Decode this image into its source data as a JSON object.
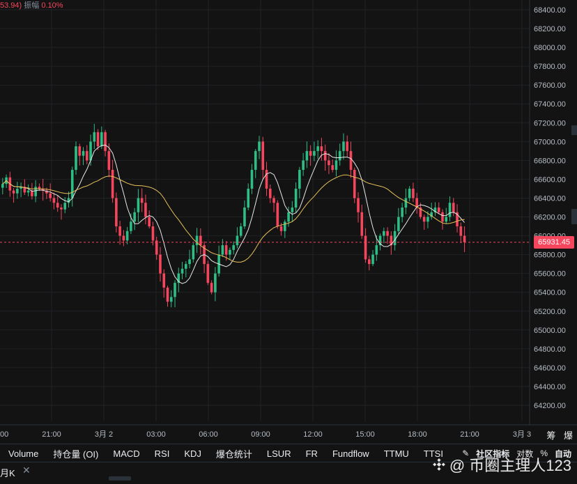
{
  "header": {
    "price_fragment": "53.94)",
    "amplitude_label": "振幅",
    "amplitude_value": "0.10%"
  },
  "last_price": "65931.45",
  "side_tabs": [
    "筹",
    "爆"
  ],
  "indicators": [
    "Volume",
    "持仓量 (OI)",
    "MACD",
    "RSI",
    "KDJ",
    "爆仓统计",
    "LSUR",
    "FR",
    "Fundflow",
    "TTMU",
    "TTSI"
  ],
  "toolbar_right": {
    "community": "社区指标",
    "log": "对数",
    "percent": "%",
    "auto": "自动"
  },
  "sub_bar": {
    "timeframe": "月K",
    "close": "✕"
  },
  "watermark": "@ 币圈主理人123",
  "colors": {
    "up": "#2ebd85",
    "down": "#f6465d",
    "ma_fast": "#e8e8e8",
    "ma_slow": "#e7c15a",
    "grid": "#1f2326"
  },
  "chart_data": {
    "type": "candlestick",
    "y_ticks": [
      68400,
      68200,
      68000,
      67800,
      67600,
      67400,
      67200,
      67000,
      66800,
      66600,
      66400,
      66200,
      66000,
      65800,
      65600,
      65400,
      65200,
      65000,
      64800,
      64600,
      64400,
      64200
    ],
    "y_tick_labels": [
      "68400.00",
      "68200.00",
      "68000.00",
      "67800.00",
      "67600.00",
      "67400.00",
      "67200.00",
      "67000.00",
      "66800.00",
      "66600.00",
      "66400.00",
      "66200.00",
      "66000.00",
      "65800.00",
      "65600.00",
      "65400.00",
      "65200.00",
      "65000.00",
      "64800.00",
      "64600.00",
      "64400.00",
      "64200.00"
    ],
    "x_tick_labels": [
      "00",
      "21:00",
      "3月 2",
      "03:00",
      "06:00",
      "09:00",
      "12:00",
      "15:00",
      "18:00",
      "21:00",
      "3月 3"
    ],
    "last_price": 65931.45,
    "closes": [
      66550,
      66620,
      66480,
      66450,
      66500,
      66520,
      66460,
      66480,
      66420,
      66520,
      66500,
      66480,
      66450,
      66400,
      66350,
      66300,
      66280,
      66350,
      66400,
      66700,
      66950,
      66850,
      66900,
      66800,
      67000,
      67100,
      66950,
      67100,
      66900,
      66700,
      66400,
      66100,
      66000,
      65950,
      66050,
      66150,
      66250,
      66400,
      66350,
      66200,
      66100,
      65950,
      65800,
      65600,
      65450,
      65300,
      65350,
      65500,
      65600,
      65650,
      65700,
      65750,
      65900,
      66000,
      65900,
      65700,
      65500,
      65400,
      65600,
      65800,
      65900,
      65800,
      65850,
      65900,
      66000,
      66100,
      66300,
      66500,
      66700,
      66900,
      67000,
      66700,
      66500,
      66400,
      66350,
      66100,
      66050,
      66150,
      66250,
      66300,
      66500,
      66700,
      66800,
      66900,
      66850,
      66900,
      66950,
      66900,
      66800,
      66750,
      66700,
      66800,
      66900,
      67000,
      66900,
      66700,
      66400,
      66250,
      66000,
      65750,
      65700,
      65800,
      65900,
      66000,
      66050,
      66000,
      65900,
      66050,
      66200,
      66300,
      66400,
      66500,
      66400,
      66300,
      66200,
      66150,
      66200,
      66250,
      66300,
      66250,
      66150,
      66200,
      66350,
      66250,
      66100,
      66000,
      65931.45
    ]
  }
}
